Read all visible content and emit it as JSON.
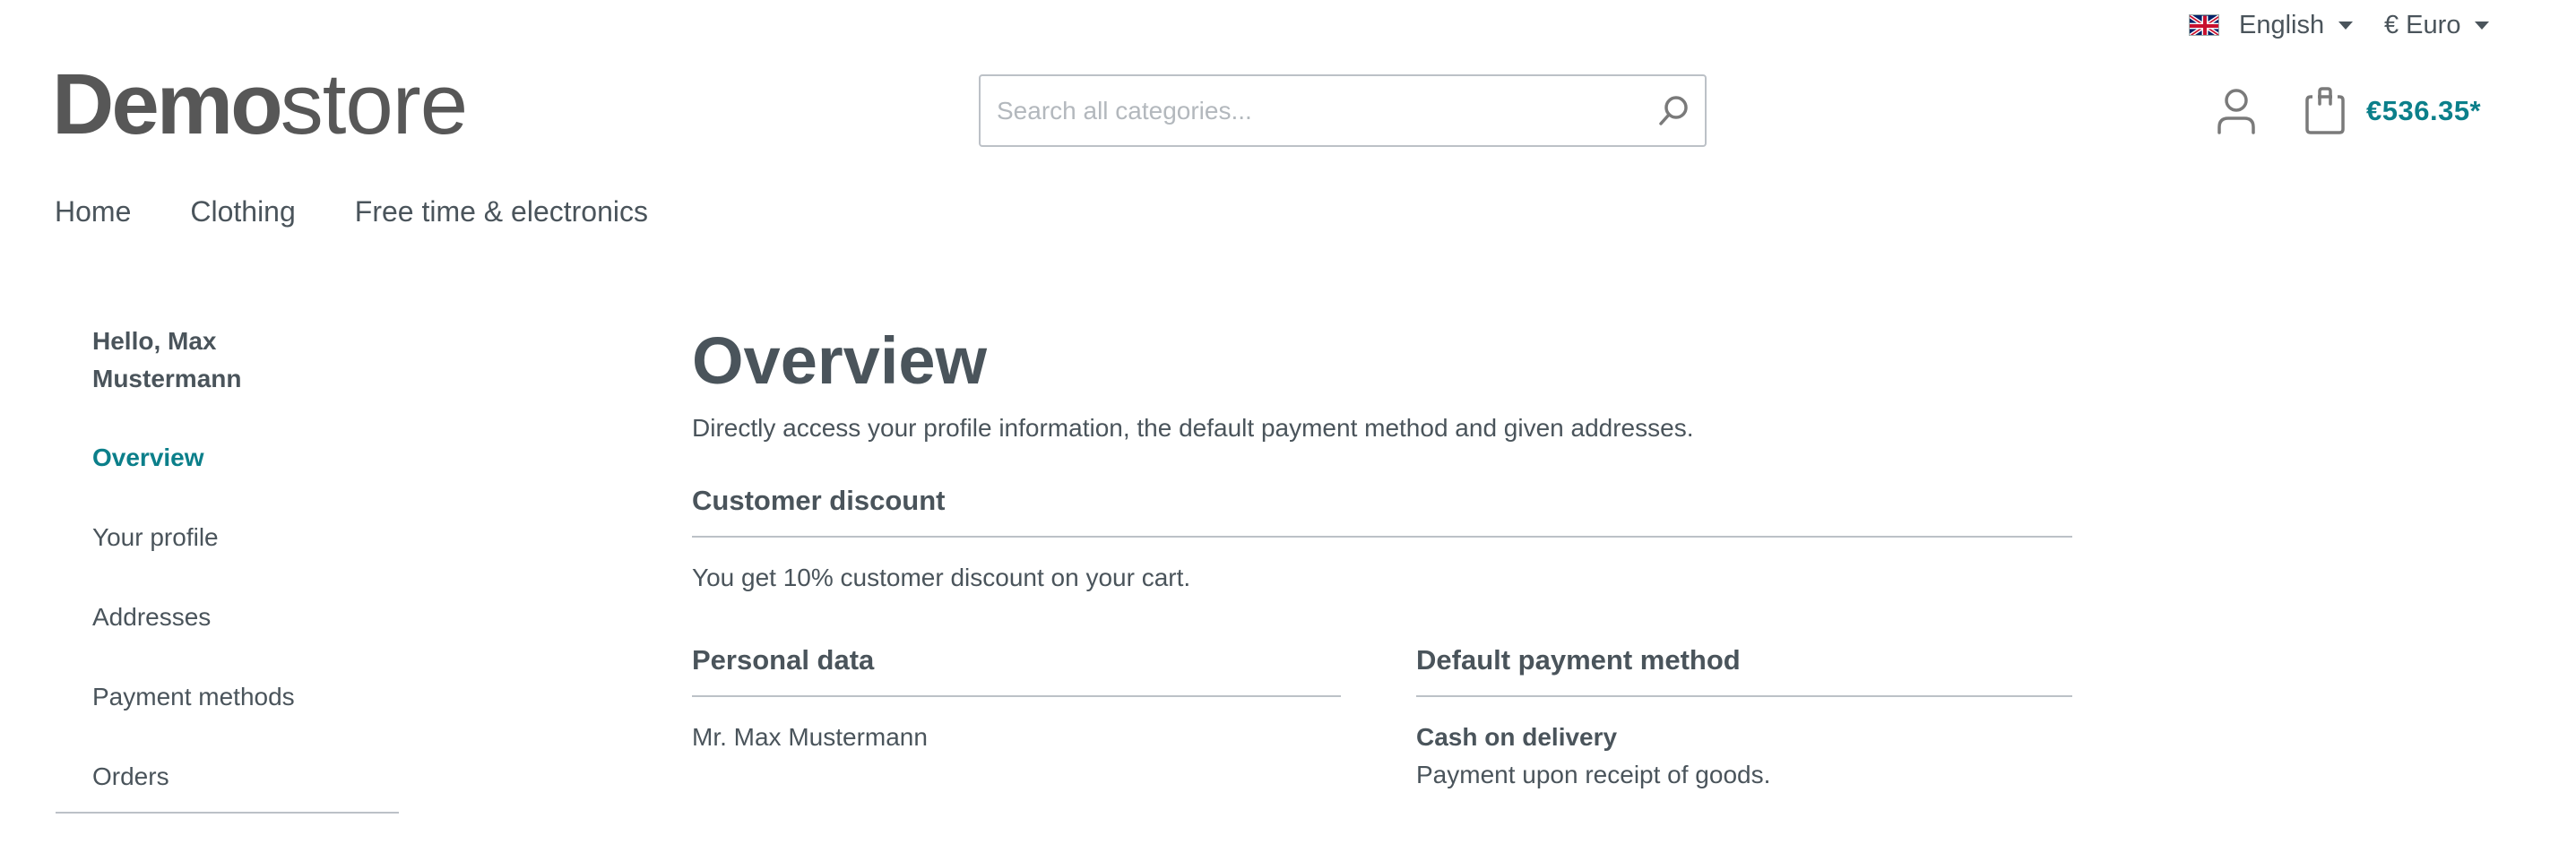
{
  "topbar": {
    "language": {
      "flag_icon": "uk-flag-icon",
      "label": "English"
    },
    "currency": {
      "label": "€ Euro"
    }
  },
  "header": {
    "logo": {
      "bold": "Demo",
      "light": "store"
    },
    "search": {
      "placeholder": "Search all categories...",
      "value": ""
    },
    "cart": {
      "total": "€536.35*"
    }
  },
  "nav": {
    "items": [
      {
        "label": "Home"
      },
      {
        "label": "Clothing"
      },
      {
        "label": "Free time & electronics"
      }
    ]
  },
  "sidebar": {
    "greeting": "Hello, Max Mustermann",
    "items": [
      {
        "label": "Overview",
        "active": true
      },
      {
        "label": "Your profile"
      },
      {
        "label": "Addresses"
      },
      {
        "label": "Payment methods"
      },
      {
        "label": "Orders"
      }
    ]
  },
  "main": {
    "title": "Overview",
    "lead": "Directly access your profile information, the default payment method and given addresses.",
    "customer_discount": {
      "title": "Customer discount",
      "text": "You get 10% customer discount on your cart."
    },
    "personal_data": {
      "title": "Personal data",
      "name": "Mr. Max Mustermann"
    },
    "payment": {
      "title": "Default payment method",
      "method": "Cash on delivery",
      "description": "Payment upon receipt of goods."
    }
  },
  "colors": {
    "accent": "#0b7f8a",
    "text": "#4a545b",
    "divider": "#bcc1c7",
    "logo": "#575757"
  }
}
